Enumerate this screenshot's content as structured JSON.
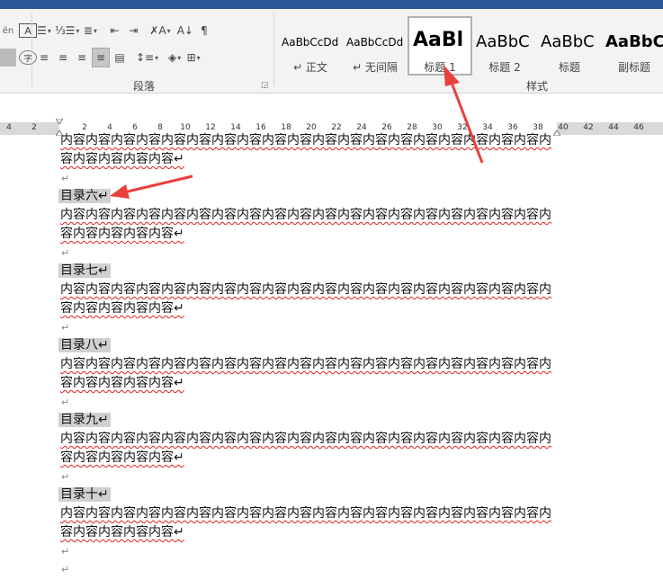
{
  "ribbon": {
    "paragraph_group_label": "段落",
    "styles_group_label": "样式",
    "styles": [
      {
        "sample": "AaBbCcDd",
        "name": "↵ 正文",
        "active": false
      },
      {
        "sample": "AaBbCcDd",
        "name": "↵ 无间隔",
        "active": false
      },
      {
        "sample": "AaBl",
        "name": "标题 1",
        "active": true
      },
      {
        "sample": "AaBbC",
        "name": "标题 2",
        "active": false
      },
      {
        "sample": "AaBbC",
        "name": "标题",
        "active": false
      },
      {
        "sample": "AaBbC",
        "name": "副标题",
        "active": false
      }
    ]
  },
  "ruler": {
    "ticks": [
      "4",
      "2",
      "2",
      "4",
      "6",
      "8",
      "10",
      "12",
      "14",
      "16",
      "18",
      "20",
      "22",
      "24",
      "26",
      "28",
      "30",
      "32",
      "34",
      "36",
      "38",
      "40",
      "42",
      "44",
      "46"
    ]
  },
  "document": {
    "sections": [
      {
        "heading": "",
        "lines": [
          "内容内容内容内容内容内容内容内容内容内容内容内容内容内容内容内容内容内容内容内",
          "容内容内容内容内容↵",
          "↵"
        ]
      },
      {
        "heading": "目录六↵",
        "lines": [
          "内容内容内容内容内容内容内容内容内容内容内容内容内容内容内容内容内容内容内容内",
          "容内容内容内容内容↵",
          "↵"
        ]
      },
      {
        "heading": "目录七↵",
        "lines": [
          "内容内容内容内容内容内容内容内容内容内容内容内容内容内容内容内容内容内容内容内",
          "容内容内容内容内容↵",
          "↵"
        ]
      },
      {
        "heading": "目录八↵",
        "lines": [
          "内容内容内容内容内容内容内容内容内容内容内容内容内容内容内容内容内容内容内容内",
          "容内容内容内容内容↵",
          "↵"
        ]
      },
      {
        "heading": "目录九↵",
        "lines": [
          "内容内容内容内容内容内容内容内容内容内容内容内容内容内容内容内容内容内容内容内",
          "容内容内容内容内容↵",
          "↵"
        ]
      },
      {
        "heading": "目录十↵",
        "lines": [
          "内容内容内容内容内容内容内容内容内容内容内容内容内容内容内容内容内容内容内容内",
          "容内容内容内容内容↵",
          "↵",
          "↵"
        ]
      }
    ]
  },
  "colors": {
    "accent": "#2b579a",
    "annotation_arrow": "#e8413c",
    "heading_shade": "#d0d0d0",
    "spelling_underline": "#e02020"
  }
}
